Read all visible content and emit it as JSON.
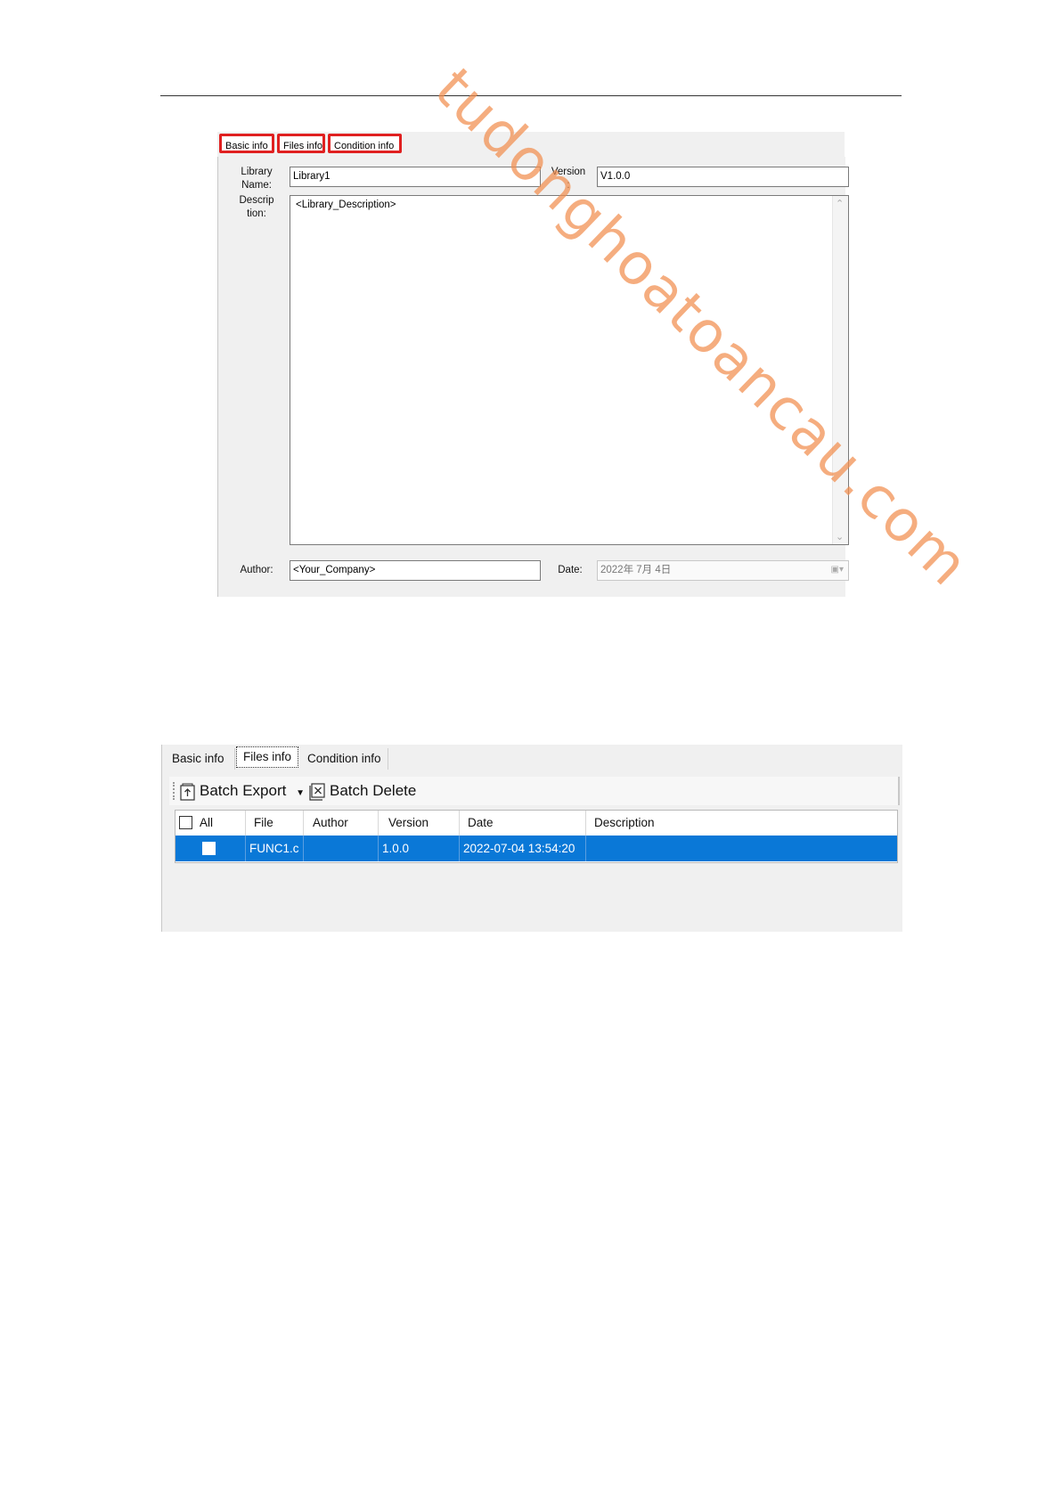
{
  "shot1": {
    "tabs": [
      "Basic info",
      "Files info",
      "Condition info"
    ],
    "library_name_label": "Library\nName:",
    "library_name_value": "Library1",
    "version_label": "Version\n:",
    "version_value": "V1.0.0",
    "description_label": "Descrip\ntion:",
    "description_value": "<Library_Description>",
    "author_label": "Author:",
    "author_value": "<Your_Company>",
    "date_label": "Date:",
    "date_value": "2022年  7月  4日",
    "highlight_color": "#e02020"
  },
  "shot2": {
    "tabs": [
      "Basic info",
      "Files info",
      "Condition info"
    ],
    "active_tab": "Files info",
    "toolbar": {
      "batch_export": "Batch Export",
      "batch_delete": "Batch Delete"
    },
    "columns": [
      "All",
      "File",
      "Author",
      "Version",
      "Date",
      "Description"
    ],
    "rows": [
      {
        "checked": false,
        "file": "FUNC1.c",
        "author": "",
        "version": "1.0.0",
        "date": "2022-07-04 13:54:20",
        "description": ""
      }
    ],
    "selection_color": "#0a78d7"
  },
  "watermark": "tudonghoatoancau.com"
}
